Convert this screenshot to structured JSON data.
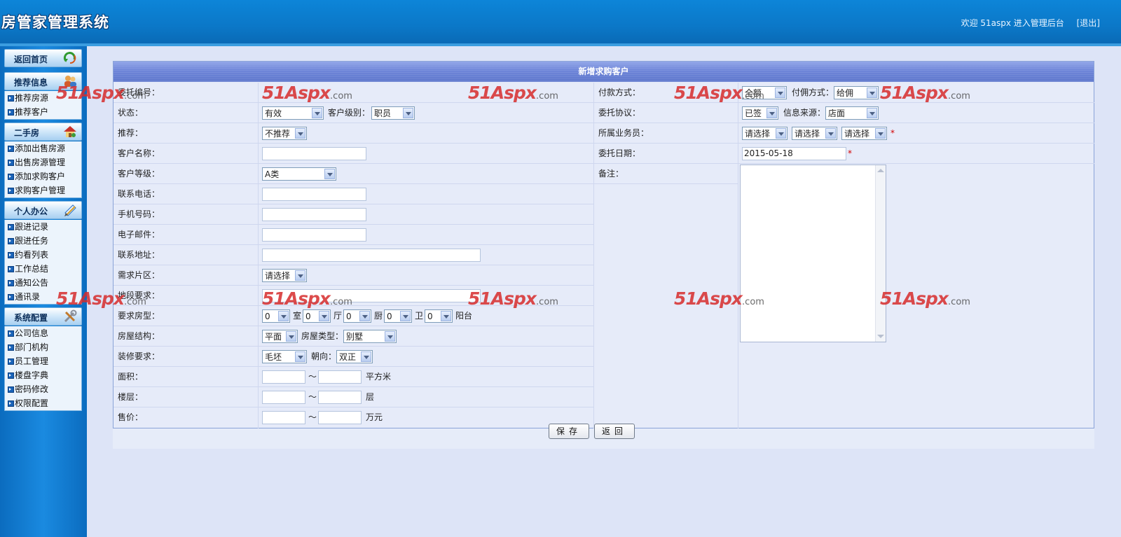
{
  "header": {
    "app_title": "房管家管理系统",
    "welcome_text": "欢迎 51aspx 进入管理后台",
    "logout": "[退出]"
  },
  "sidebar": {
    "sections": [
      {
        "title": "返回首页",
        "icon": "home-arrow-icon",
        "items": []
      },
      {
        "title": "推荐信息",
        "icon": "users-icon",
        "items": [
          "推荐房源",
          "推荐客户"
        ]
      },
      {
        "title": "二手房",
        "icon": "house-icon",
        "items": [
          "添加出售房源",
          "出售房源管理",
          "添加求购客户",
          "求购客户管理"
        ]
      },
      {
        "title": "个人办公",
        "icon": "notepad-icon",
        "items": [
          "跟进记录",
          "跟进任务",
          "约看列表",
          "工作总结",
          "通知公告",
          "通讯录"
        ]
      },
      {
        "title": "系统配置",
        "icon": "tools-icon",
        "items": [
          "公司信息",
          "部门机构",
          "员工管理",
          "楼盘字典",
          "密码修改",
          "权限配置"
        ]
      }
    ]
  },
  "form": {
    "title": "新增求购客户",
    "left_labels": [
      "委托编号：",
      "状态：",
      "推荐：",
      "客户名称：",
      "客户等级：",
      "联系电话：",
      "手机号码：",
      "电子邮件：",
      "联系地址：",
      "需求片区：",
      "地段要求：",
      "要求房型：",
      "房屋结构：",
      "装修要求：",
      "面积：",
      "楼层：",
      "售价："
    ],
    "status": {
      "value": "有效",
      "level_label": "客户级别：",
      "level_value": "职员"
    },
    "recommend": "不推荐",
    "customer_grade": "A类",
    "district": "请选择",
    "room_type": {
      "rooms": "0",
      "room_unit": "室",
      "halls": "0",
      "hall_unit": "厅",
      "kitchens": "0",
      "kitchen_unit": "厨",
      "baths": "0",
      "bath_unit": "卫",
      "balconies": "0",
      "balcony_unit": "阳台"
    },
    "structure": {
      "value": "平面",
      "type_label": "房屋类型：",
      "type_value": "别墅"
    },
    "decoration": {
      "value": "毛坯",
      "orient_label": "朝向：",
      "orient_value": "双正"
    },
    "range_sep": "～",
    "area_unit": "平方米",
    "floor_unit": "层",
    "price_unit": "万元",
    "right_labels": [
      "付款方式：",
      "委托协议：",
      "所属业务员：",
      "委托日期：",
      "备注："
    ],
    "payment": {
      "value": "全额",
      "commission_label": "付佣方式：",
      "commission_value": "给佣"
    },
    "agreement": {
      "value": "已签",
      "source_label": "信息来源：",
      "source_value": "店面"
    },
    "salesman": [
      "请选择",
      "请选择",
      "请选择"
    ],
    "required_mark": "*",
    "date": "2015-05-18"
  },
  "buttons": {
    "save": "保存",
    "back": "返回"
  },
  "watermark": {
    "brand": "51Aspx",
    "suffix": ".com"
  }
}
